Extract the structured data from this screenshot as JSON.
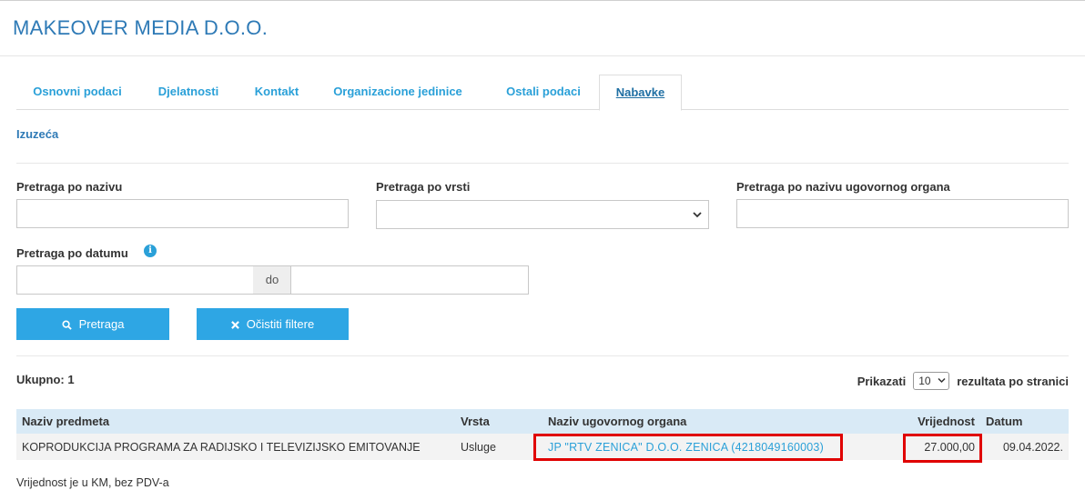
{
  "company": {
    "title": "MAKEOVER MEDIA D.O.O."
  },
  "tabs": [
    {
      "label": "Osnovni podaci"
    },
    {
      "label": "Djelatnosti"
    },
    {
      "label": "Kontakt"
    },
    {
      "label": "Organizacione jedinice"
    },
    {
      "label": "Ostali podaci"
    },
    {
      "label": "Nabavke",
      "active": true
    }
  ],
  "subnav": {
    "link": "Izuzeća"
  },
  "filters": {
    "name_label": "Pretraga po nazivu",
    "name_value": "",
    "type_label": "Pretraga po vrsti",
    "type_value": "",
    "authority_label": "Pretraga po nazivu ugovornog organa",
    "authority_value": "",
    "date_label": "Pretraga po datumu",
    "date_from": "",
    "date_sep": "do",
    "date_to": ""
  },
  "buttons": {
    "search": "Pretraga",
    "clear": "Očistiti filtere"
  },
  "results": {
    "total": "Ukupno: 1",
    "show_label": "Prikazati",
    "per_page": "10",
    "per_page_suffix": "rezultata po stranici"
  },
  "table": {
    "headers": [
      "Naziv predmeta",
      "Vrsta",
      "Naziv ugovornog organa",
      "Vrijednost",
      "Datum"
    ],
    "rows": [
      {
        "subject": "KOPRODUKCIJA PROGRAMA ZA RADIJSKO I TELEVIZIJSKO EMITOVANJE",
        "type": "Usluge",
        "authority": "JP \"RTV ZENICA\" D.O.O. ZENICA (4218049160003)",
        "value": "27.000,00",
        "date": "09.04.2022."
      }
    ]
  },
  "footnote": "Vrijednost je u KM, bez PDV-a",
  "colors": {
    "accent": "#2ea6e4",
    "link": "#2aa0d8",
    "title": "#2e7ab6",
    "table_header": "#d9eaf6",
    "highlight": "#e00000"
  }
}
